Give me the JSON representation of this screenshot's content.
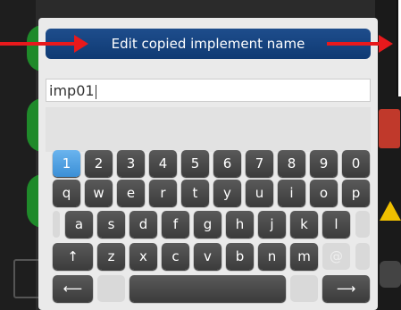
{
  "dialog": {
    "title": "Edit copied implement name",
    "field_value": "imp01"
  },
  "keyboard": {
    "row1": [
      "1",
      "2",
      "3",
      "4",
      "5",
      "6",
      "7",
      "8",
      "9",
      "0"
    ],
    "row2": [
      "q",
      "w",
      "e",
      "r",
      "t",
      "y",
      "u",
      "i",
      "o",
      "p"
    ],
    "row3": [
      "a",
      "s",
      "d",
      "f",
      "g",
      "h",
      "j",
      "k",
      "l"
    ],
    "row4": [
      "↑",
      "z",
      "x",
      "c",
      "v",
      "b",
      "n",
      "m",
      "@"
    ],
    "left_arrow": "⟵",
    "right_arrow": "⟶",
    "selected_key": "1"
  },
  "colors": {
    "title_bar": "#1e4d8c",
    "selected_key": "#3b8fd6",
    "annotation_arrow": "#e8191c"
  }
}
